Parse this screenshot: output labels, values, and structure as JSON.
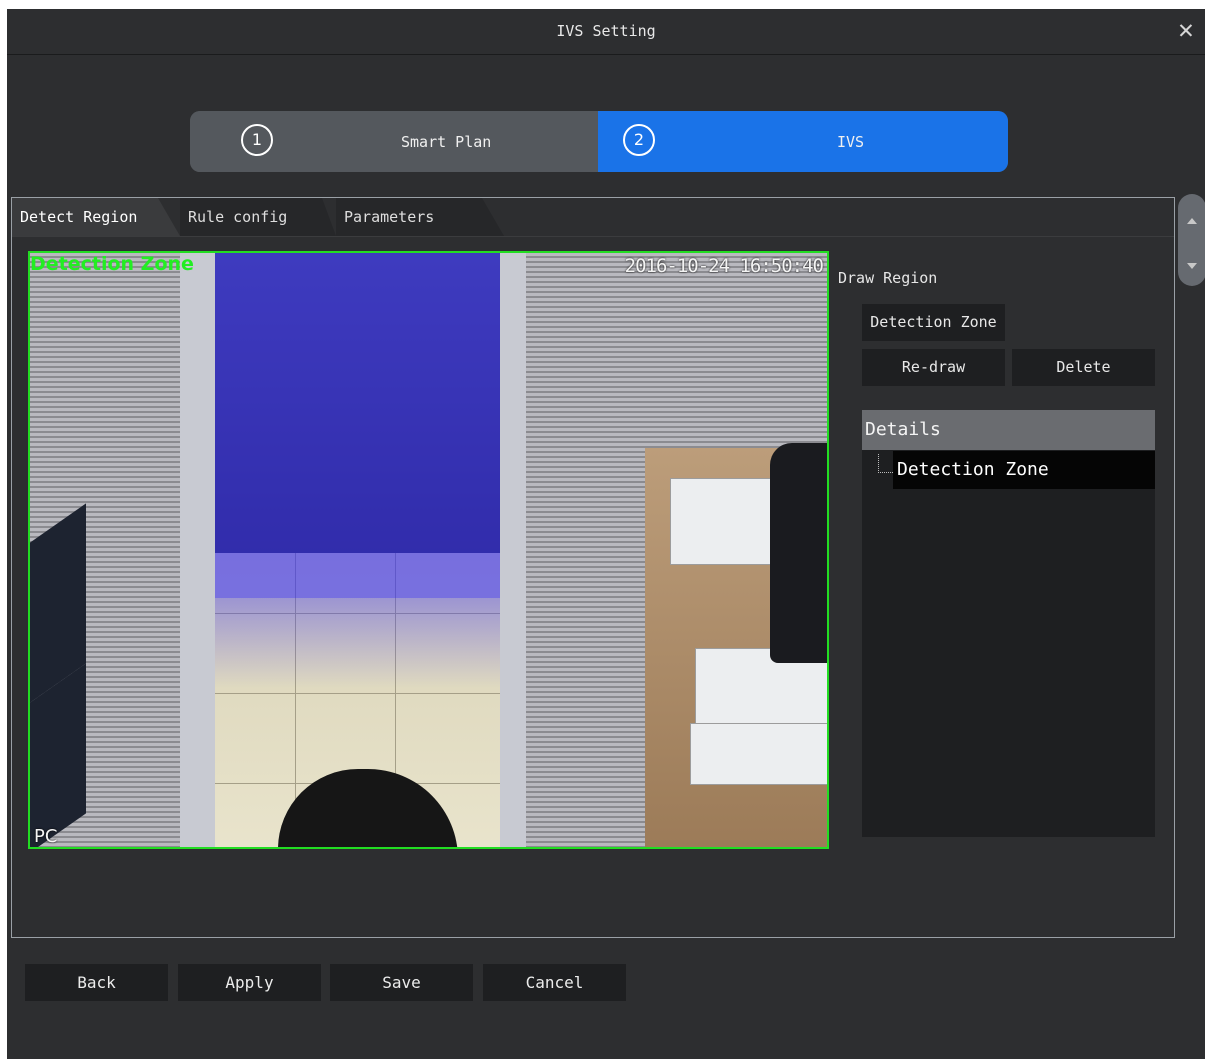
{
  "window": {
    "title": "IVS Setting",
    "close_icon": "close-icon"
  },
  "stepper": {
    "steps": [
      {
        "number": "1",
        "label": "Smart Plan",
        "active": false
      },
      {
        "number": "2",
        "label": "IVS",
        "active": true
      }
    ],
    "active_color": "#1a73e8"
  },
  "tabs": [
    {
      "label": "Detect Region",
      "active": true
    },
    {
      "label": "Rule config",
      "active": false
    },
    {
      "label": "Parameters",
      "active": false
    }
  ],
  "video": {
    "zone_label": "Detection Zone",
    "timestamp": "2016-10-24 16:50:40",
    "channel_label": "PC",
    "zone_border_color": "#22dd22",
    "zone_fill_color": "#2820ff"
  },
  "draw_region": {
    "title": "Draw Region",
    "detection_zone_button": "Detection Zone",
    "redraw_button": "Re-draw",
    "delete_button": "Delete"
  },
  "details": {
    "header": "Details",
    "items": [
      "Detection Zone"
    ]
  },
  "footer": {
    "back": "Back",
    "apply": "Apply",
    "save": "Save",
    "cancel": "Cancel"
  }
}
